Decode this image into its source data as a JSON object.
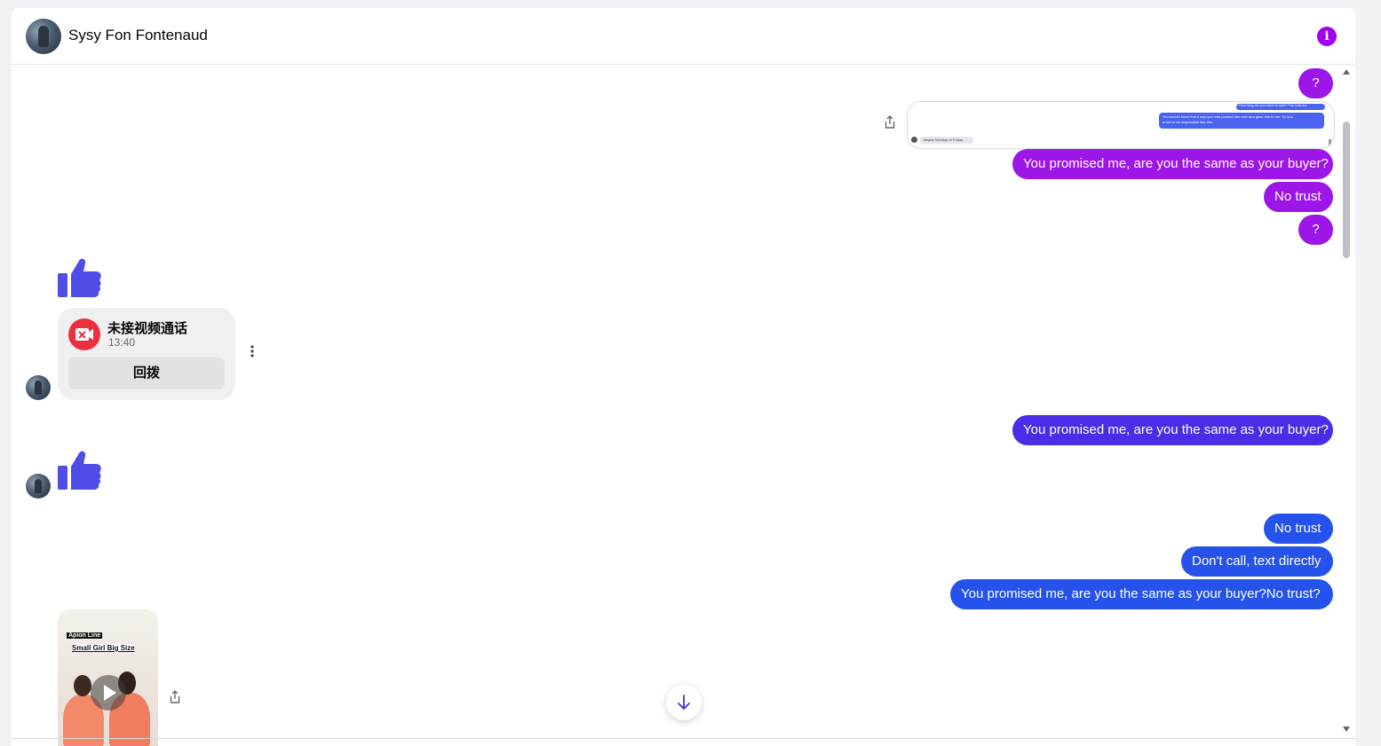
{
  "header": {
    "contact_name": "Sysy Fon Fontenaud",
    "info_icon": "info-icon"
  },
  "messages": {
    "q1": "?",
    "promise1": "You promised me, are you the same as your buyer?",
    "no_trust1": "No trust",
    "q2": "?",
    "promise2": "You promised me, are you the same as your buyer?",
    "no_trust2": "No trust",
    "dont_call": "Don't call, text directly",
    "promise3": "You promised me, are you the same as your buyer?No trust?"
  },
  "missed_call": {
    "title": "未接视频通话",
    "time": "13:40",
    "callback_label": "回拨"
  },
  "preview": {
    "line1": "How long do you have to wait? You told me",
    "line2": "You should know that it was you who pushed him over and gave him to me. So you",
    "line3": "a rich to be responsible like this.",
    "reply": "Maybe Monday or Friday"
  },
  "video": {
    "caption1": "Apion Line",
    "caption2": "Small Girl Big Size"
  },
  "colors": {
    "purple": "#9c16e8",
    "indigo": "#4a2de6",
    "blue": "#2452eb",
    "thumb": "#4f4de6",
    "missed_call_red": "#ea2f3f"
  }
}
